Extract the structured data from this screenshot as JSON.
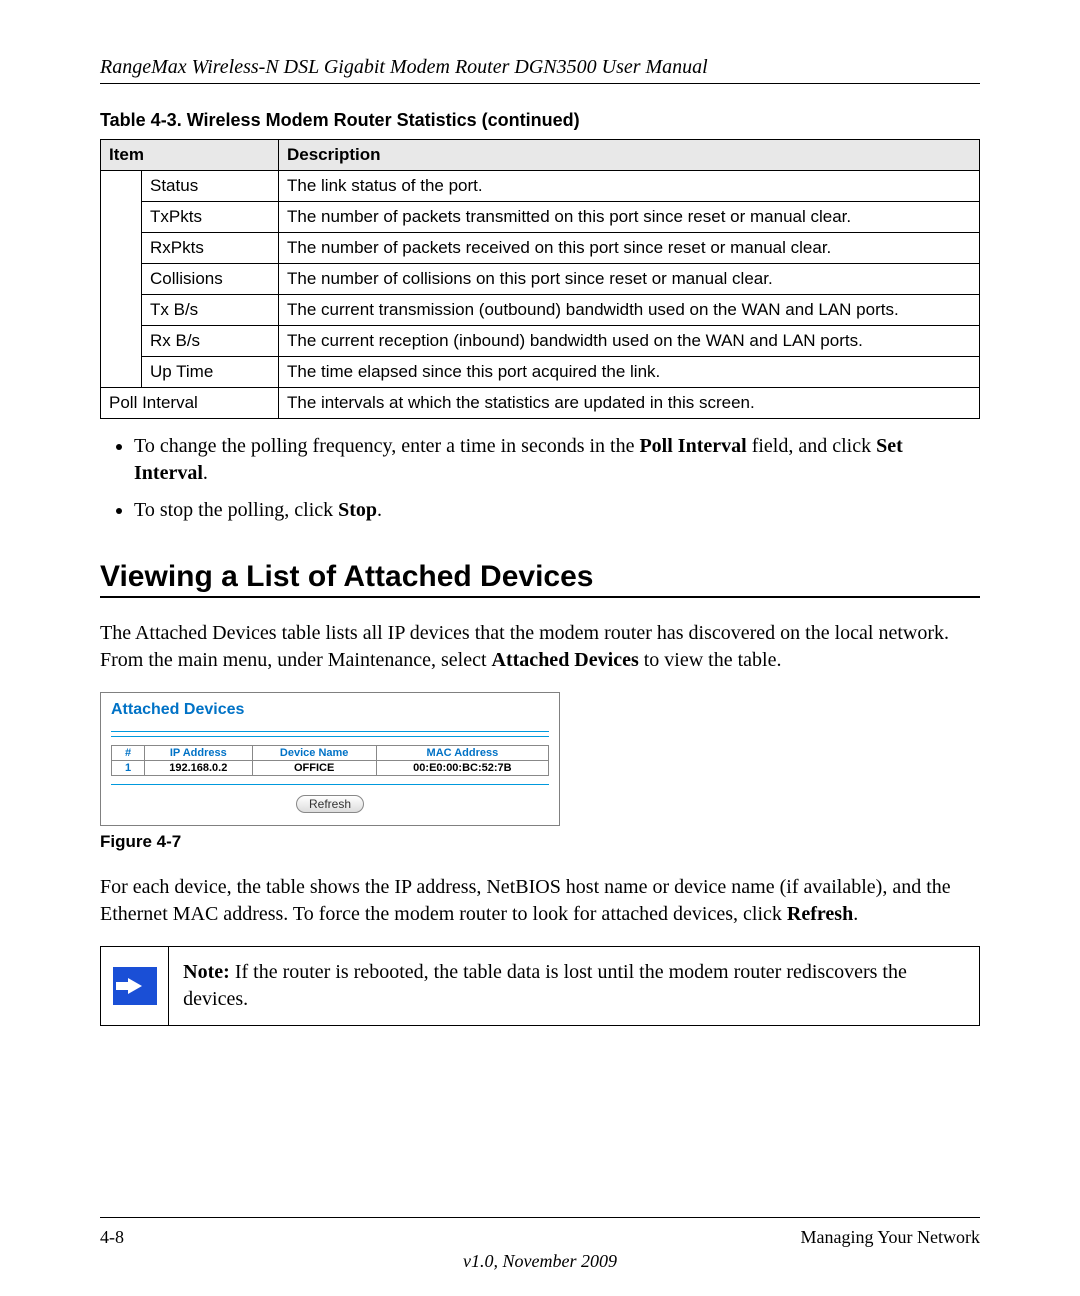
{
  "header_title": "RangeMax Wireless-N DSL Gigabit Modem Router DGN3500 User Manual",
  "table_caption": "Table 4-3.  Wireless Modem Router Statistics  (continued)",
  "table_headers": {
    "item": "Item",
    "description": "Description"
  },
  "table_rows": [
    {
      "indent": true,
      "item": "Status",
      "description": "The link status of the port."
    },
    {
      "indent": true,
      "item": "TxPkts",
      "description": "The number of packets transmitted on this port since reset or manual clear."
    },
    {
      "indent": true,
      "item": "RxPkts",
      "description": "The number of packets received on this port since reset or manual clear."
    },
    {
      "indent": true,
      "item": "Collisions",
      "description": "The number of collisions on this port since reset or manual clear."
    },
    {
      "indent": true,
      "item": "Tx B/s",
      "description": "The current transmission (outbound) bandwidth used on the WAN and LAN ports."
    },
    {
      "indent": true,
      "item": "Rx B/s",
      "description": "The current reception (inbound) bandwidth used on the WAN and LAN ports."
    },
    {
      "indent": true,
      "item": "Up Time",
      "description": "The time elapsed since this port acquired the link."
    },
    {
      "indent": false,
      "item": "Poll Interval",
      "description": "The intervals at which the statistics are updated in this screen."
    }
  ],
  "bullets": {
    "b1_pre": "To change the polling frequency, enter a time in seconds in the ",
    "b1_bold1": "Poll Interval",
    "b1_mid": " field, and click ",
    "b1_bold2": "Set Interval",
    "b1_post": ".",
    "b2_pre": "To stop the polling, click ",
    "b2_bold": "Stop",
    "b2_post": "."
  },
  "section_heading": "Viewing a List of Attached Devices",
  "intro_para_pre": "The Attached Devices table lists all IP devices that the modem router has discovered on the local network. From the main menu, under Maintenance, select ",
  "intro_para_bold": "Attached Devices",
  "intro_para_post": " to view the table.",
  "screenshot": {
    "title": "Attached Devices",
    "headers": {
      "num": "#",
      "ip": "IP Address",
      "name": "Device Name",
      "mac": "MAC Address"
    },
    "row": {
      "num": "1",
      "ip": "192.168.0.2",
      "name": "OFFICE",
      "mac": "00:E0:00:BC:52:7B"
    },
    "refresh": "Refresh"
  },
  "figure_caption": "Figure 4-7",
  "after_figure_pre": "For each device, the table shows the IP address, NetBIOS host name or device name (if available), and the Ethernet MAC address. To force the modem router to look for attached devices, click ",
  "after_figure_bold": "Refresh",
  "after_figure_post": ".",
  "note": {
    "label": "Note:",
    "text": " If the router is rebooted, the table data is lost until the modem router rediscovers the devices."
  },
  "footer": {
    "page": "4-8",
    "section": "Managing Your Network",
    "version": "v1.0, November 2009"
  }
}
